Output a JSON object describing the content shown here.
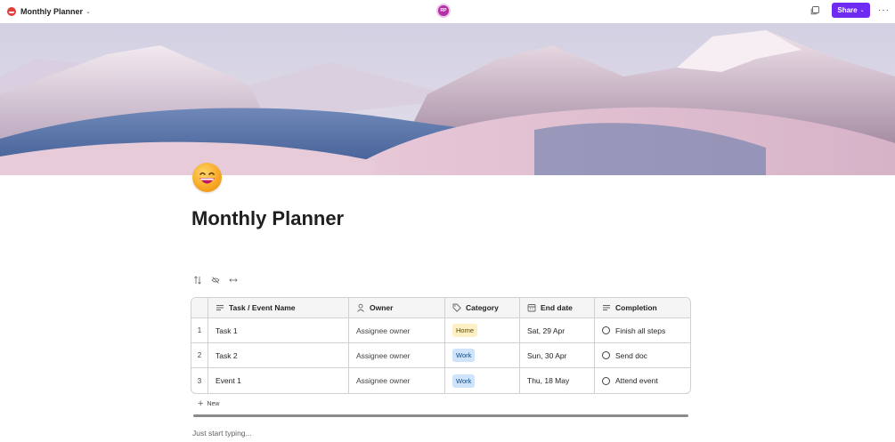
{
  "topbar": {
    "title": "Monthly Planner",
    "avatar_initials": "RP",
    "share_label": "Share",
    "icons": [
      "loop-logo-icon",
      "chevron-down-icon",
      "copy-icon",
      "more-icon"
    ]
  },
  "page": {
    "emoji": "grinning-face-icon",
    "title": "Monthly Planner",
    "placeholder": "Just start typing..."
  },
  "toolbar": {
    "icons": [
      "sort-icon",
      "hide-icon",
      "resize-icon"
    ]
  },
  "table": {
    "columns": [
      {
        "label": "Task / Event Name",
        "icon": "text-lines-icon"
      },
      {
        "label": "Owner",
        "icon": "person-icon"
      },
      {
        "label": "Category",
        "icon": "tag-icon"
      },
      {
        "label": "End date",
        "icon": "calendar-icon"
      },
      {
        "label": "Completion",
        "icon": "text-lines-icon"
      }
    ],
    "rows": [
      {
        "num": "1",
        "name": "Task 1",
        "owner": "Assignee owner",
        "category": "Home",
        "end_date": "Sat, 29 Apr",
        "completion": "Finish all steps"
      },
      {
        "num": "2",
        "name": "Task 2",
        "owner": "Assignee owner",
        "category": "Work",
        "end_date": "Sun, 30 Apr",
        "completion": "Send doc"
      },
      {
        "num": "3",
        "name": "Event 1",
        "owner": "Assignee owner",
        "category": "Work",
        "end_date": "Thu, 18 May",
        "completion": "Attend event"
      }
    ],
    "new_label": "New"
  },
  "colors": {
    "accent": "#6e2cf3",
    "tag_home": "#fdf0c4",
    "tag_work": "#cfe4fa",
    "avatar": "#b52ea8"
  }
}
